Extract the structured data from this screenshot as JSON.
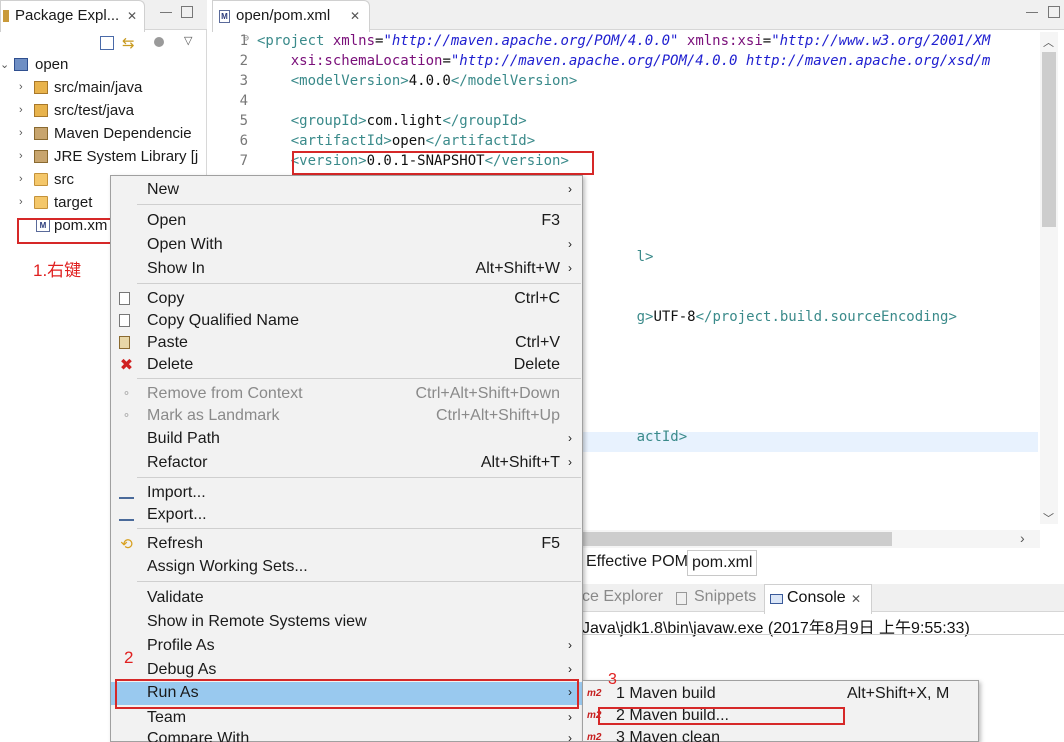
{
  "package_explorer": {
    "tab_title": "Package Expl...",
    "tree": [
      {
        "label": "open",
        "icon": "project-icon"
      },
      {
        "label": "src/main/java",
        "icon": "package-folder-icon"
      },
      {
        "label": "src/test/java",
        "icon": "package-folder-icon"
      },
      {
        "label": "Maven Dependencie",
        "icon": "library-icon"
      },
      {
        "label": "JRE System Library [j",
        "icon": "library-icon"
      },
      {
        "label": "src",
        "icon": "folder-icon"
      },
      {
        "label": "target",
        "icon": "folder-icon"
      },
      {
        "label": "pom.xm",
        "icon": "xml-file-icon"
      }
    ]
  },
  "annotations": {
    "step1": "1.右键",
    "step2": "2",
    "step3": "3"
  },
  "editor": {
    "tab_title": "open/pom.xml",
    "lines": [
      {
        "n": "1",
        "text_a": "<project ",
        "text_b": "xmlns",
        "text_c": "=",
        "text_d": "\"http://maven.apache.org/POM/4.0.0\"",
        "text_e": " xmlns:xsi",
        "text_f": "=",
        "text_g": "\"http://www.w3.org/2001/XM"
      },
      {
        "n": "2",
        "text_a": "    xsi:schemaLocation",
        "text_b": "=",
        "text_c": "\"http://maven.apache.org/POM/4.0.0 http://maven.apache.org/xsd/m"
      },
      {
        "n": "3",
        "text_a": "    <modelVersion>",
        "text_b": "4.0.0",
        "text_c": "</modelVersion>"
      },
      {
        "n": "4"
      },
      {
        "n": "5",
        "text_a": "    <groupId>",
        "text_b": "com.light",
        "text_c": "</groupId>"
      },
      {
        "n": "6",
        "text_a": "    <artifactId>",
        "text_b": "open",
        "text_c": "</artifactId>"
      },
      {
        "n": "7",
        "text_a": "    <version>",
        "text_b": "0.0.1-SNAPSHOT",
        "text_c": "</version>"
      }
    ],
    "visible_fragments": {
      "frag1": "l>",
      "frag2_tag_a": "g>",
      "frag2_text": "UTF-8",
      "frag2_tag_b": "</project.build.sourceEncoding>",
      "frag3": "actId>"
    },
    "bottom_tabs": [
      "Effective POM",
      "pom.xml"
    ]
  },
  "console": {
    "tabs": [
      "ce Explorer",
      "Snippets",
      "Console"
    ],
    "line": "Java\\jdk1.8\\bin\\javaw.exe (2017年8月9日 上午9:55:33)"
  },
  "context_menu": {
    "items": [
      {
        "label": "New",
        "shortcut": "",
        "submenu": true
      },
      {
        "label": "Open",
        "shortcut": "F3"
      },
      {
        "label": "Open With",
        "shortcut": "",
        "submenu": true
      },
      {
        "label": "Show In",
        "shortcut": "Alt+Shift+W",
        "submenu": true
      },
      {
        "label": "Copy",
        "shortcut": "Ctrl+C"
      },
      {
        "label": "Copy Qualified Name",
        "shortcut": ""
      },
      {
        "label": "Paste",
        "shortcut": "Ctrl+V"
      },
      {
        "label": "Delete",
        "shortcut": "Delete"
      },
      {
        "label": "Remove from Context",
        "shortcut": "Ctrl+Alt+Shift+Down"
      },
      {
        "label": "Mark as Landmark",
        "shortcut": "Ctrl+Alt+Shift+Up"
      },
      {
        "label": "Build Path",
        "shortcut": "",
        "submenu": true
      },
      {
        "label": "Refactor",
        "shortcut": "Alt+Shift+T",
        "submenu": true
      },
      {
        "label": "Import...",
        "shortcut": ""
      },
      {
        "label": "Export...",
        "shortcut": ""
      },
      {
        "label": "Refresh",
        "shortcut": "F5"
      },
      {
        "label": "Assign Working Sets...",
        "shortcut": ""
      },
      {
        "label": "Validate",
        "shortcut": ""
      },
      {
        "label": "Show in Remote Systems view",
        "shortcut": ""
      },
      {
        "label": "Profile As",
        "shortcut": "",
        "submenu": true
      },
      {
        "label": "Debug As",
        "shortcut": "",
        "submenu": true
      },
      {
        "label": "Run As",
        "shortcut": "",
        "submenu": true
      },
      {
        "label": "Team",
        "shortcut": "",
        "submenu": true
      },
      {
        "label": "Compare With",
        "shortcut": "",
        "submenu": true
      }
    ]
  },
  "run_as_submenu": {
    "items": [
      {
        "label": "1 Maven build",
        "shortcut": "Alt+Shift+X, M",
        "icon_text": "m2"
      },
      {
        "label": "2 Maven build...",
        "shortcut": "",
        "icon_text": "m2"
      },
      {
        "label": "3 Maven clean",
        "shortcut": "",
        "icon_text": "m2"
      }
    ]
  },
  "colors": {
    "highlight_box": "#d62828",
    "menu_selected": "#99c9ef",
    "xml_tag": "#3a8a8a",
    "xml_attr": "#7a0f7a",
    "xml_string": "#2020d0"
  }
}
